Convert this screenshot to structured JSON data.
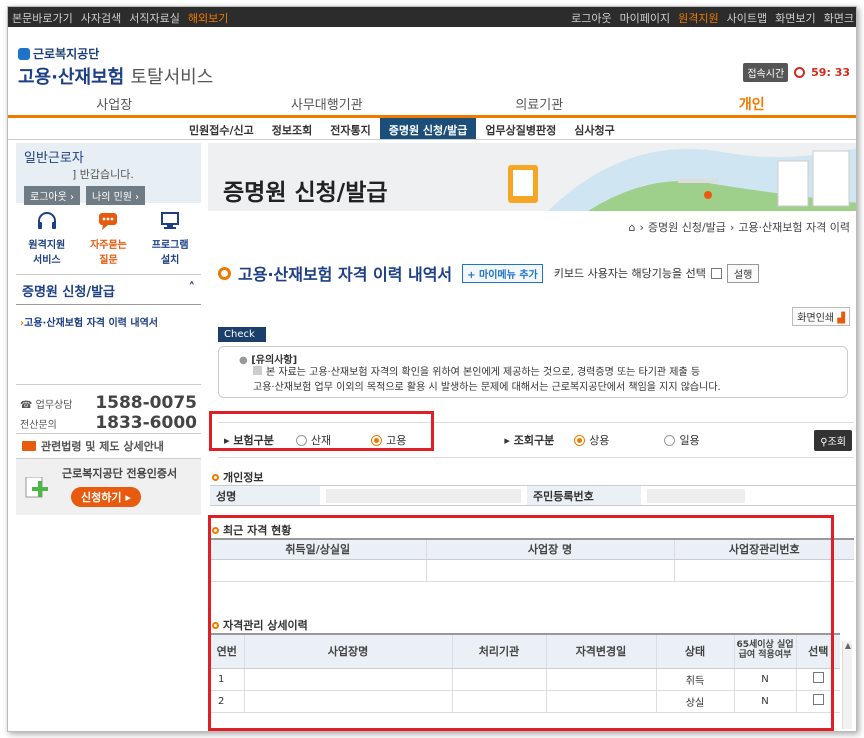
{
  "topbar": {
    "left": [
      "본문바로가기",
      "사자검색",
      "서직자료실",
      "해외보기"
    ],
    "right": [
      "로그아웃",
      "마이페이지",
      "원격지원",
      "사이트맵",
      "화면보기",
      "화면크"
    ]
  },
  "logo": {
    "small": "근로복지공단",
    "big": "고용·산재보험",
    "big_suffix": "토탈서비스"
  },
  "session": {
    "label": "접속시간",
    "time": "59: 33"
  },
  "main_tabs": [
    "사업장",
    "사무대행기관",
    "의료기관",
    "개인"
  ],
  "sub_nav": [
    "민원접수/신고",
    "정보조회",
    "전자통지",
    "증명원 신청/발급",
    "업무상질병판정",
    "심사청구"
  ],
  "sidebar": {
    "user_type": "일반근로자",
    "greeting": "] 반갑습니다.",
    "logout": "로그아웃",
    "my_petition": "나의 민원",
    "quick": [
      {
        "label1": "원격지원",
        "label2": "서비스"
      },
      {
        "label1": "자주묻는",
        "label2": "질문"
      },
      {
        "label1": "프로그램",
        "label2": "설치"
      }
    ],
    "section": "증명원 신청/발급",
    "item": "고용·산재보험 자격 이력 내역서",
    "phone1_label": "업무상담",
    "phone1": "1588-0075",
    "phone2_label": "전산문의",
    "phone2": "1833-6000",
    "law": "관련법령 및 제도 상세안내",
    "cert_title": "근로복지공단 전용인증서",
    "cert_btn": "신청하기"
  },
  "banner": {
    "title": "증명원 신청/발급"
  },
  "breadcrumb": [
    "증명원 신청/발급",
    "고용·산재보험 자격 이력"
  ],
  "page": {
    "title": "고용·산재보험 자격 이력 내역서",
    "mymenu": "마이메뉴 추가",
    "kb_text": "키보드 사용자는 해당기능을 선택",
    "setting": "설행",
    "print": "화면인쇄"
  },
  "check": {
    "tag": "Check",
    "heading": "[유의사항]",
    "line1": "본 자료는 고용·산재보험 자격의 확인을 위하여 본인에게 제공하는 것으로, 경력증명 또는 타기관 제출 등",
    "line2": "고용·산재보험 업무 이외의 목적으로 활용 시 발생하는 문제에 대해서는 근로복지공단에서 책임을 지지 않습니다."
  },
  "search": {
    "insurance_label": "보험구분",
    "opt_sanjae": "산재",
    "opt_goyong": "고용",
    "query_label": "조회구분",
    "opt_sangyong": "상용",
    "opt_ilyong": "일용",
    "query_btn": "조회"
  },
  "personal": {
    "title": "개인정보",
    "name_label": "성명",
    "rrn_label": "주민등록번호"
  },
  "recent": {
    "title": "최근 자격 현황",
    "cols": [
      "취득일/상실일",
      "사업장 명",
      "사업장관리번호"
    ]
  },
  "detail": {
    "title": "자격관리 상세이력",
    "cols": [
      "연번",
      "사업장명",
      "처리기관",
      "자격변경일",
      "상태",
      "65세이상 실업급여 적용여부",
      "선택"
    ],
    "rows": [
      {
        "no": "1",
        "status": "취득",
        "age65": "N"
      },
      {
        "no": "2",
        "status": "상실",
        "age65": "N"
      }
    ]
  }
}
